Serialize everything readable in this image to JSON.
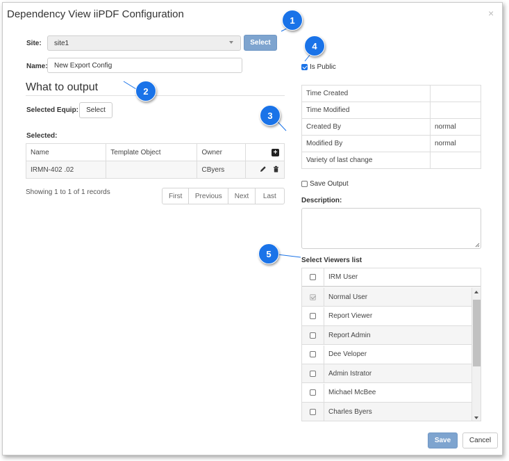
{
  "dialog": {
    "title": "Dependency View iiPDF Configuration",
    "close_glyph": "×"
  },
  "site": {
    "label": "Site:",
    "value": "site1",
    "select_button": "Select"
  },
  "name": {
    "label": "Name:",
    "value": "New Export Config"
  },
  "output": {
    "heading": "What to output",
    "selected_equip_label": "Selected Equip:",
    "select_button": "Select",
    "selected_label": "Selected:",
    "columns": [
      "Name",
      "Template Object",
      "Owner"
    ],
    "rows": [
      {
        "name": "IRMN-402 .02",
        "template_object": "",
        "owner": "CByers"
      }
    ],
    "records_text": "Showing 1 to 1 of 1 records",
    "pager": [
      "First",
      "Previous",
      "Next",
      "Last"
    ]
  },
  "is_public": {
    "label": "Is Public",
    "checked": true
  },
  "meta": {
    "rows": [
      {
        "label": "Time Created",
        "value": ""
      },
      {
        "label": "Time Modified",
        "value": ""
      },
      {
        "label": "Created By",
        "value": "normal"
      },
      {
        "label": "Modified By",
        "value": "normal"
      },
      {
        "label": "Variety of last change",
        "value": ""
      }
    ]
  },
  "save_output": {
    "label": "Save Output",
    "checked": false
  },
  "description": {
    "label": "Description:",
    "value": ""
  },
  "viewers": {
    "label": "Select Viewers list",
    "header": "IRM User",
    "items": [
      {
        "name": "Normal User",
        "state": "disabled-checked"
      },
      {
        "name": "Report Viewer",
        "state": "unchecked"
      },
      {
        "name": "Report Admin",
        "state": "unchecked"
      },
      {
        "name": "Dee Veloper",
        "state": "unchecked"
      },
      {
        "name": "Admin Istrator",
        "state": "unchecked"
      },
      {
        "name": "Michael McBee",
        "state": "unchecked"
      },
      {
        "name": "Charles Byers",
        "state": "unchecked"
      }
    ]
  },
  "footer": {
    "save": "Save",
    "cancel": "Cancel"
  },
  "callouts": [
    "1",
    "2",
    "3",
    "4",
    "5"
  ],
  "colors": {
    "accent": "#1a73e8",
    "button_primary": "#7ea4cf"
  }
}
